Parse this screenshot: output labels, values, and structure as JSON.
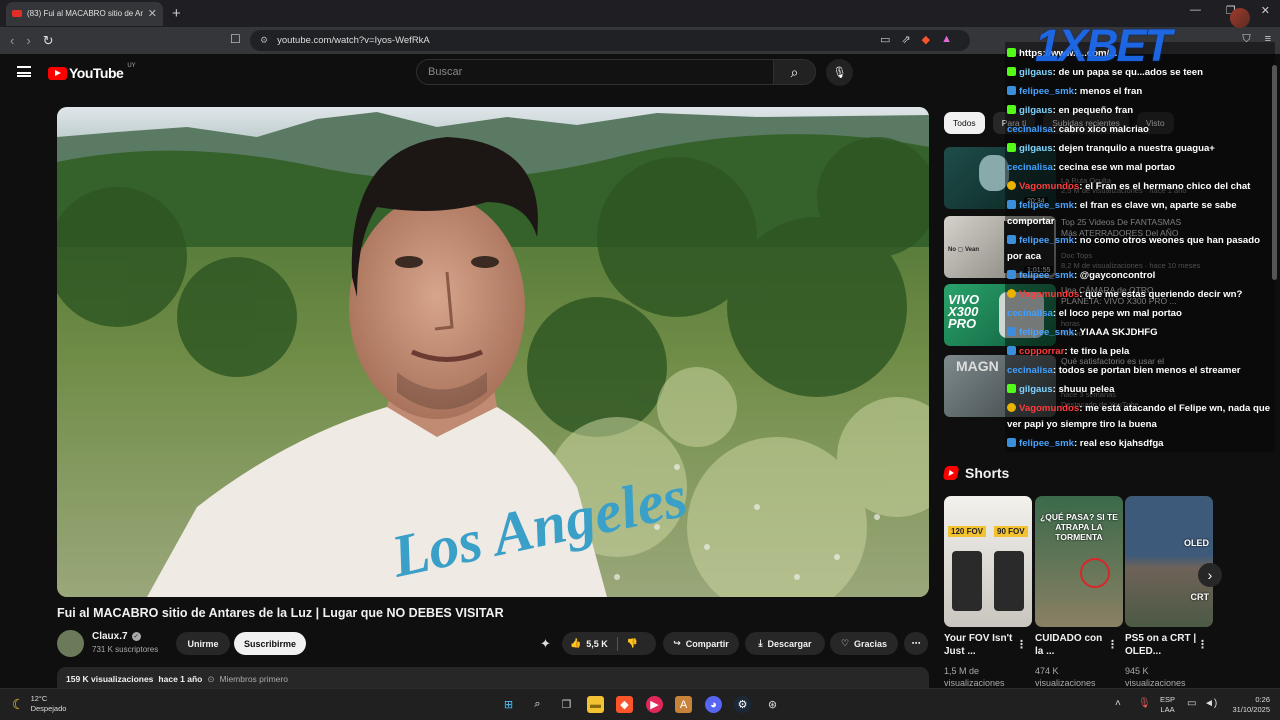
{
  "browser": {
    "tab_title": "(83) Fui al MACABRO sitio de An",
    "new_tab": "+",
    "url": "youtube.com/watch?v=Iyos-WefRkA"
  },
  "youtube": {
    "logo": "YouTube",
    "country": "UY",
    "search_placeholder": "Buscar"
  },
  "video": {
    "title": "Fui al MACABRO sitio de Antares de la Luz | Lugar que NO DEBES VISITAR",
    "channel": "Claux.7",
    "subscribers": "731 K suscriptores",
    "join": "Unirme",
    "subscribe": "Suscribirme",
    "likes": "5,5 K",
    "share": "Compartir",
    "download": "Descargar",
    "thanks": "Gracias",
    "views": "159 K visualizaciones",
    "age": "hace 1 año",
    "members": "Miembros primero",
    "shirt_text": "Los Angeles"
  },
  "chips": [
    "Todos",
    "Para ti",
    "Subidas recientes",
    "Visto"
  ],
  "recommendations": [
    {
      "title": "",
      "meta1": "La Ruta Oculta",
      "meta2": "2,5 M de visualizaciones · hace 1 año",
      "duration": "20:34"
    },
    {
      "title": "Top 25 Videos De FANTASMAS Más ATERRADORES Del AÑO",
      "meta1": "Doc Tops",
      "meta2": "8,2 M de visualizaciones · hace 10 meses",
      "duration": "1:01:55"
    },
    {
      "title": "Una CÁMARA de OTRO PLANETA: VIVO X300 PRO ...",
      "meta1": "",
      "meta2": "horas",
      "badge": "Nuevo"
    },
    {
      "title": "Qué satisfactorio es usar el",
      "meta1": "",
      "meta2": "hace 3 semanas",
      "note": "Destacado de YouTube"
    }
  ],
  "chat_overlay": {
    "brand": "1XBET",
    "messages": [
      {
        "badge": "ki",
        "user": "",
        "color": "#ffffff",
        "text": "https://www.t...com/...",
        "wrap": false
      },
      {
        "badge": "ki",
        "user": "gilgaus",
        "color": "#7fd3ff",
        "text": ": de un papa se qu...ados se teen",
        "wrap": false
      },
      {
        "badge": "tw",
        "user": "felipee_smk",
        "color": "#4aa3ff",
        "text": ": menos el fran",
        "wrap": false
      },
      {
        "badge": "ki",
        "user": "gilgaus",
        "color": "#7fd3ff",
        "text": ": en pequeño fran",
        "wrap": false
      },
      {
        "badge": "",
        "user": "cecinalisa",
        "color": "#3fa0ff",
        "text": ": cabro xico malcriao",
        "wrap": false
      },
      {
        "badge": "ki",
        "user": "gilgaus",
        "color": "#7fd3ff",
        "text": ": dejen tranquilo a nuestra guagua+",
        "wrap": false
      },
      {
        "badge": "",
        "user": "cecinalisa",
        "color": "#3fa0ff",
        "text": ": cecina ese wn mal portao",
        "wrap": false
      },
      {
        "badge": "yt",
        "user": "Vagomundos",
        "color": "#ff3b3b",
        "text": ": el Fran es el hermano chico del chat",
        "wrap": false
      },
      {
        "badge": "tw",
        "user": "felipee_smk",
        "color": "#4aa3ff",
        "text": ": el fran es clave wn, aparte se sabe comportar",
        "wrap": true
      },
      {
        "badge": "tw",
        "user": "felipee_smk",
        "color": "#4aa3ff",
        "text": ": no como otros weones que han pasado por aca",
        "wrap": true
      },
      {
        "badge": "tw",
        "user": "felipee_smk",
        "color": "#4aa3ff",
        "text": ": @gayconcontrol",
        "wrap": false
      },
      {
        "badge": "yt",
        "user": "Vagomundos",
        "color": "#ff3b3b",
        "text": ": que me estas queriendo decir wn?",
        "wrap": false
      },
      {
        "badge": "",
        "user": "cecinalisa",
        "color": "#3fa0ff",
        "text": ": el loco pepe wn mal portao",
        "wrap": false
      },
      {
        "badge": "tw",
        "user": "felipee_smk",
        "color": "#4aa3ff",
        "text": ": YIAAA SKJDHFG",
        "wrap": false
      },
      {
        "badge": "tw",
        "user": "copporrar",
        "color": "#ff3b3b",
        "text": ": te tiro la pela",
        "wrap": false
      },
      {
        "badge": "",
        "user": "cecinalisa",
        "color": "#3fa0ff",
        "text": ": todos se portan bien menos el streamer",
        "wrap": false
      },
      {
        "badge": "ki",
        "user": "gilgaus",
        "color": "#7fd3ff",
        "text": ": shuuu pelea",
        "wrap": false
      },
      {
        "badge": "yt",
        "user": "Vagomundos",
        "color": "#ff3b3b",
        "text": ": me está atacando el Felipe wn, nada que ver papi yo siempre tiro la buena",
        "wrap": true
      },
      {
        "badge": "tw",
        "user": "felipee_smk",
        "color": "#4aa3ff",
        "text": ": real eso kjahsdfga",
        "wrap": false
      }
    ]
  },
  "shorts": {
    "heading": "Shorts",
    "items": [
      {
        "title": "Your FOV Isn't Just ...",
        "views1": "1,5 M de",
        "views2": "visualizaciones",
        "thumb_top": "120 FOV",
        "thumb_right": "90 FOV"
      },
      {
        "title": "CUIDADO con la ...",
        "views1": "474 K",
        "views2": "visualizaciones",
        "thumb_top": "¿QUÉ PASA? SI TE ATRAPA LA TORMENTA"
      },
      {
        "title": "PS5 on a CRT | OLED...",
        "views1": "945 K",
        "views2": "visualizaciones",
        "thumb_top": "OLED",
        "thumb_bottom": "CRT"
      }
    ]
  },
  "taskbar": {
    "temp": "12°C",
    "weather": "Despejado",
    "lang1": "ESP",
    "lang2": "LAA",
    "time": "0:26",
    "date": "31/10/2025"
  }
}
